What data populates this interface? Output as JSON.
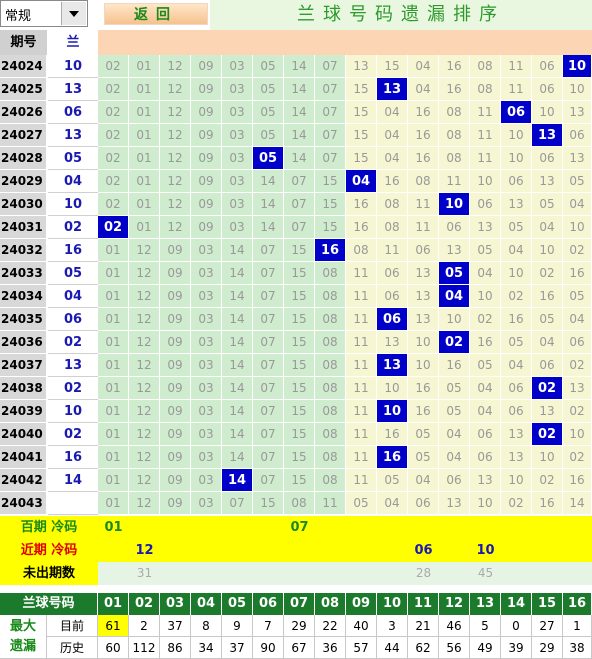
{
  "toolbar": {
    "dropdown_value": "常规",
    "back_label": "返回",
    "title": "兰球号码遗漏排序"
  },
  "columns": {
    "period_header": "期号",
    "number_header": "兰"
  },
  "rows": [
    {
      "period": "24024",
      "num": "10",
      "cells": [
        "02",
        "01",
        "12",
        "09",
        "03",
        "05",
        "14",
        "07",
        "13",
        "15",
        "04",
        "16",
        "08",
        "11",
        "06",
        "10"
      ],
      "hit": 15
    },
    {
      "period": "24025",
      "num": "13",
      "cells": [
        "02",
        "01",
        "12",
        "09",
        "03",
        "05",
        "14",
        "07",
        "15",
        "13",
        "04",
        "16",
        "08",
        "11",
        "06",
        "10"
      ],
      "hit": 9
    },
    {
      "period": "24026",
      "num": "06",
      "cells": [
        "02",
        "01",
        "12",
        "09",
        "03",
        "05",
        "14",
        "07",
        "15",
        "04",
        "16",
        "08",
        "11",
        "06",
        "10",
        "13"
      ],
      "hit": 13
    },
    {
      "period": "24027",
      "num": "13",
      "cells": [
        "02",
        "01",
        "12",
        "09",
        "03",
        "05",
        "14",
        "07",
        "15",
        "04",
        "16",
        "08",
        "11",
        "10",
        "13",
        "06"
      ],
      "hit": 14
    },
    {
      "period": "24028",
      "num": "05",
      "cells": [
        "02",
        "01",
        "12",
        "09",
        "03",
        "05",
        "14",
        "07",
        "15",
        "04",
        "16",
        "08",
        "11",
        "10",
        "06",
        "13"
      ],
      "hit": 5
    },
    {
      "period": "24029",
      "num": "04",
      "cells": [
        "02",
        "01",
        "12",
        "09",
        "03",
        "14",
        "07",
        "15",
        "04",
        "16",
        "08",
        "11",
        "10",
        "06",
        "13",
        "05"
      ],
      "hit": 8
    },
    {
      "period": "24030",
      "num": "10",
      "cells": [
        "02",
        "01",
        "12",
        "09",
        "03",
        "14",
        "07",
        "15",
        "16",
        "08",
        "11",
        "10",
        "06",
        "13",
        "05",
        "04"
      ],
      "hit": 11
    },
    {
      "period": "24031",
      "num": "02",
      "cells": [
        "02",
        "01",
        "12",
        "09",
        "03",
        "14",
        "07",
        "15",
        "16",
        "08",
        "11",
        "06",
        "13",
        "05",
        "04",
        "10"
      ],
      "hit": 0
    },
    {
      "period": "24032",
      "num": "16",
      "cells": [
        "01",
        "12",
        "09",
        "03",
        "14",
        "07",
        "15",
        "16",
        "08",
        "11",
        "06",
        "13",
        "05",
        "04",
        "10",
        "02"
      ],
      "hit": 7
    },
    {
      "period": "24033",
      "num": "05",
      "cells": [
        "01",
        "12",
        "09",
        "03",
        "14",
        "07",
        "15",
        "08",
        "11",
        "06",
        "13",
        "05",
        "04",
        "10",
        "02",
        "16"
      ],
      "hit": 11
    },
    {
      "period": "24034",
      "num": "04",
      "cells": [
        "01",
        "12",
        "09",
        "03",
        "14",
        "07",
        "15",
        "08",
        "11",
        "06",
        "13",
        "04",
        "10",
        "02",
        "16",
        "05"
      ],
      "hit": 11
    },
    {
      "period": "24035",
      "num": "06",
      "cells": [
        "01",
        "12",
        "09",
        "03",
        "14",
        "07",
        "15",
        "08",
        "11",
        "06",
        "13",
        "10",
        "02",
        "16",
        "05",
        "04"
      ],
      "hit": 9
    },
    {
      "period": "24036",
      "num": "02",
      "cells": [
        "01",
        "12",
        "09",
        "03",
        "14",
        "07",
        "15",
        "08",
        "11",
        "13",
        "10",
        "02",
        "16",
        "05",
        "04",
        "06"
      ],
      "hit": 11
    },
    {
      "period": "24037",
      "num": "13",
      "cells": [
        "01",
        "12",
        "09",
        "03",
        "14",
        "07",
        "15",
        "08",
        "11",
        "13",
        "10",
        "16",
        "05",
        "04",
        "06",
        "02"
      ],
      "hit": 9
    },
    {
      "period": "24038",
      "num": "02",
      "cells": [
        "01",
        "12",
        "09",
        "03",
        "14",
        "07",
        "15",
        "08",
        "11",
        "10",
        "16",
        "05",
        "04",
        "06",
        "02",
        "13"
      ],
      "hit": 14
    },
    {
      "period": "24039",
      "num": "10",
      "cells": [
        "01",
        "12",
        "09",
        "03",
        "14",
        "07",
        "15",
        "08",
        "11",
        "10",
        "16",
        "05",
        "04",
        "06",
        "13",
        "02"
      ],
      "hit": 9
    },
    {
      "period": "24040",
      "num": "02",
      "cells": [
        "01",
        "12",
        "09",
        "03",
        "14",
        "07",
        "15",
        "08",
        "11",
        "16",
        "05",
        "04",
        "06",
        "13",
        "02",
        "10"
      ],
      "hit": 14
    },
    {
      "period": "24041",
      "num": "16",
      "cells": [
        "01",
        "12",
        "09",
        "03",
        "14",
        "07",
        "15",
        "08",
        "11",
        "16",
        "05",
        "04",
        "06",
        "13",
        "10",
        "02"
      ],
      "hit": 9
    },
    {
      "period": "24042",
      "num": "14",
      "cells": [
        "01",
        "12",
        "09",
        "03",
        "14",
        "07",
        "15",
        "08",
        "11",
        "05",
        "04",
        "06",
        "13",
        "10",
        "02",
        "16"
      ],
      "hit": 4
    },
    {
      "period": "24043",
      "num": "",
      "cells": [
        "01",
        "12",
        "09",
        "03",
        "07",
        "15",
        "08",
        "11",
        "05",
        "04",
        "06",
        "13",
        "10",
        "02",
        "16",
        "14"
      ],
      "hit": -1
    }
  ],
  "stats": {
    "cold100_label": "百期 冷码",
    "cold100": [
      {
        "col": 0,
        "val": "01"
      },
      {
        "col": 6,
        "val": "07"
      }
    ],
    "recent_label": "近期 冷码",
    "recent": [
      {
        "col": 1,
        "val": "12"
      },
      {
        "col": 10,
        "val": "06"
      },
      {
        "col": 12,
        "val": "10"
      }
    ],
    "unseen_label": "未出期数",
    "unseen": [
      {
        "col": 1,
        "val": "31"
      },
      {
        "col": 10,
        "val": "28"
      },
      {
        "col": 12,
        "val": "45"
      }
    ]
  },
  "bottom": {
    "header_label": "兰球号码",
    "numbers": [
      "01",
      "02",
      "03",
      "04",
      "05",
      "06",
      "07",
      "08",
      "09",
      "10",
      "11",
      "12",
      "13",
      "14",
      "15",
      "16"
    ],
    "group_label": "最大遗漏",
    "current_label": "目前",
    "current": [
      "61",
      "2",
      "37",
      "8",
      "9",
      "7",
      "29",
      "22",
      "40",
      "3",
      "21",
      "46",
      "5",
      "0",
      "27",
      "1"
    ],
    "history_label": "历史",
    "history": [
      "60",
      "112",
      "86",
      "34",
      "37",
      "90",
      "67",
      "36",
      "57",
      "44",
      "62",
      "56",
      "49",
      "39",
      "29",
      "38"
    ]
  },
  "colors": {
    "hit_cell": "#0000c8",
    "green_zone": "#cfeccf",
    "yellow_zone": "#f6f6d2",
    "stats_bg": "#ffff00",
    "header_green": "#1c7a2c"
  }
}
